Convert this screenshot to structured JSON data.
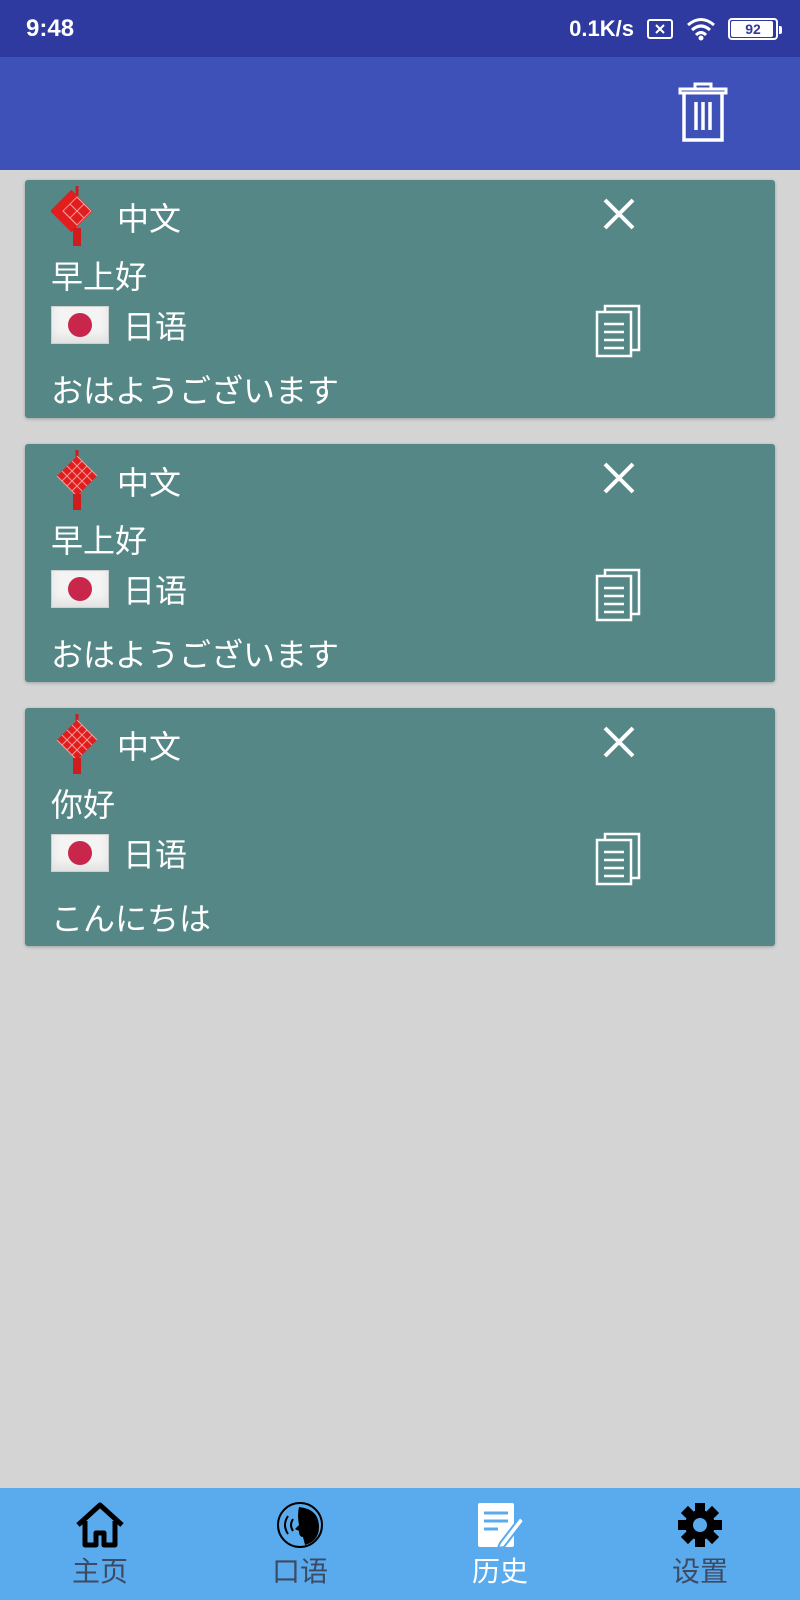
{
  "status_bar": {
    "time": "9:48",
    "net_speed": "0.1K/s",
    "battery": "92",
    "icons": [
      "sim-error-icon",
      "wifi-icon",
      "battery-icon"
    ]
  },
  "app_bar": {
    "actions": [
      "trash-icon"
    ]
  },
  "history": [
    {
      "source_lang": "中文",
      "source_text": "早上好",
      "target_lang": "日语",
      "target_text": "おはようございます"
    },
    {
      "source_lang": "中文",
      "source_text": "早上好",
      "target_lang": "日语",
      "target_text": "おはようございます"
    },
    {
      "source_lang": "中文",
      "source_text": "你好",
      "target_lang": "日语",
      "target_text": "こんにちは"
    }
  ],
  "bottom_nav": {
    "items": [
      {
        "label": "主页",
        "icon": "home-icon"
      },
      {
        "label": "口语",
        "icon": "speak-icon"
      },
      {
        "label": "历史",
        "icon": "history-icon"
      },
      {
        "label": "设置",
        "icon": "gear-icon"
      }
    ],
    "active_index": 2
  },
  "colors": {
    "status_bar": "#2e3a9f",
    "app_bar": "#3e51b8",
    "card": "#548786",
    "background": "#d4d4d4",
    "bottom_nav": "#5aabee"
  }
}
